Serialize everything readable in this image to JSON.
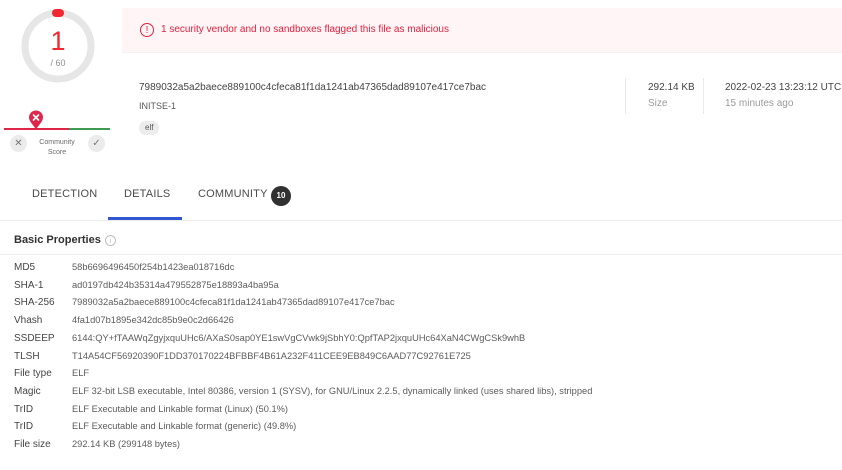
{
  "score": {
    "detected": "1",
    "total": "/ 60",
    "ring_accent": "#f0282f",
    "community_label_line1": "Community",
    "community_label_line2": "Score",
    "vote_down_icon": "close-icon",
    "vote_up_icon": "check-icon",
    "pin_icon": "close-pin-icon"
  },
  "alert": {
    "icon": "exclamation-circle-icon",
    "text": "1 security vendor and no sandboxes flagged this file as malicious",
    "color": "#e5203e"
  },
  "file": {
    "hash": "7989032a5a2baece889100c4cfeca81f1da1241ab47365dad89107e417ce7bac",
    "name": "INITSE-1",
    "tag": "elf",
    "size_value": "292.14 KB",
    "size_label": "Size",
    "date_value": "2022-02-23 13:23:12 UTC",
    "date_label": "15 minutes ago"
  },
  "tabs": [
    {
      "label": "DETECTION",
      "active": false
    },
    {
      "label": "DETAILS",
      "active": true
    },
    {
      "label": "COMMUNITY",
      "active": false,
      "badge": "10"
    }
  ],
  "tab_accent": "#2f57cf",
  "basic_properties": {
    "title": "Basic Properties",
    "info_icon": "info-icon",
    "rows": [
      {
        "key": "MD5",
        "value": "58b6696496450f254b1423ea018716dc"
      },
      {
        "key": "SHA-1",
        "value": "ad0197db424b35314a479552875e18893a4ba95a"
      },
      {
        "key": "SHA-256",
        "value": "7989032a5a2baece889100c4cfeca81f1da1241ab47365dad89107e417ce7bac"
      },
      {
        "key": "Vhash",
        "value": "4fa1d07b1895e342dc85b9e0c2d66426"
      },
      {
        "key": "SSDEEP",
        "value": "6144:QY+fTAAWqZgyjxquUHc6/AXaS0sap0YE1swVgCVwk9jSbhY0:QpfTAP2jxquUHc64XaN4CWgCSk9whB"
      },
      {
        "key": "TLSH",
        "value": "T14A54CF56920390F1DD370170224BFBBF4B61A232F411CEE9EB849C6AAD77C92761E725"
      },
      {
        "key": "File type",
        "value": "ELF"
      },
      {
        "key": "Magic",
        "value": "ELF 32-bit LSB executable, Intel 80386, version 1 (SYSV), for GNU/Linux 2.2.5, dynamically linked (uses shared libs), stripped"
      },
      {
        "key": "TrID",
        "value": "ELF Executable and Linkable format (Linux) (50.1%)"
      },
      {
        "key": "TrID",
        "value": "ELF Executable and Linkable format (generic) (49.8%)"
      },
      {
        "key": "File size",
        "value": "292.14 KB (299148 bytes)"
      }
    ]
  }
}
